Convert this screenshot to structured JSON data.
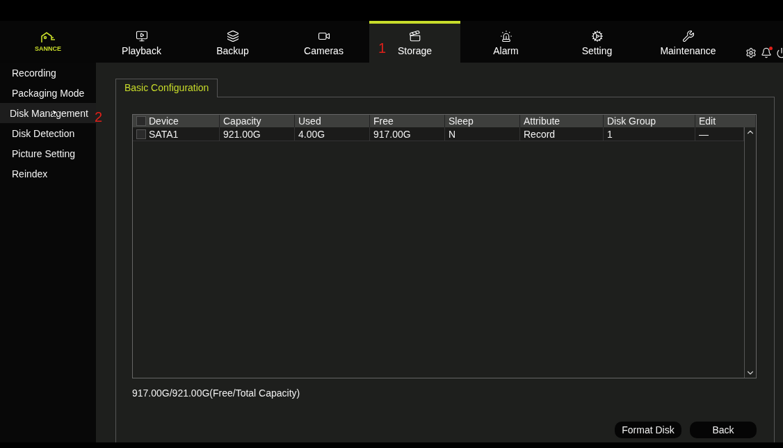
{
  "logo": {
    "text": "SANNCE"
  },
  "nav": [
    {
      "label": "Playback",
      "selected": false
    },
    {
      "label": "Backup",
      "selected": false
    },
    {
      "label": "Cameras",
      "selected": false
    },
    {
      "label": "Storage",
      "selected": true
    },
    {
      "label": "Alarm",
      "selected": false
    },
    {
      "label": "Setting",
      "selected": false
    },
    {
      "label": "Maintenance",
      "selected": false
    }
  ],
  "annotations": [
    "1",
    "2"
  ],
  "sidebar": {
    "items": [
      {
        "label": "Recording",
        "selected": false
      },
      {
        "label": "Packaging Mode",
        "selected": false
      },
      {
        "label": "Disk Management",
        "selected": true
      },
      {
        "label": "Disk Detection",
        "selected": false
      },
      {
        "label": "Picture Setting",
        "selected": false
      },
      {
        "label": "Reindex",
        "selected": false
      }
    ]
  },
  "tabs": [
    {
      "label": "Basic Configuration",
      "selected": true
    }
  ],
  "table": {
    "header_checked": false,
    "columns": [
      "Device",
      "Capacity",
      "Used",
      "Free",
      "Sleep",
      "Attribute",
      "Disk Group",
      "Edit"
    ],
    "rows": [
      {
        "checked": false,
        "cells": [
          "SATA1",
          "921.00G",
          "4.00G",
          "917.00G",
          "N",
          "Record",
          "1",
          "—"
        ]
      }
    ]
  },
  "capacity_summary": "917.00G/921.00G(Free/Total Capacity)",
  "buttons": [
    "Format Disk",
    "Back"
  ]
}
